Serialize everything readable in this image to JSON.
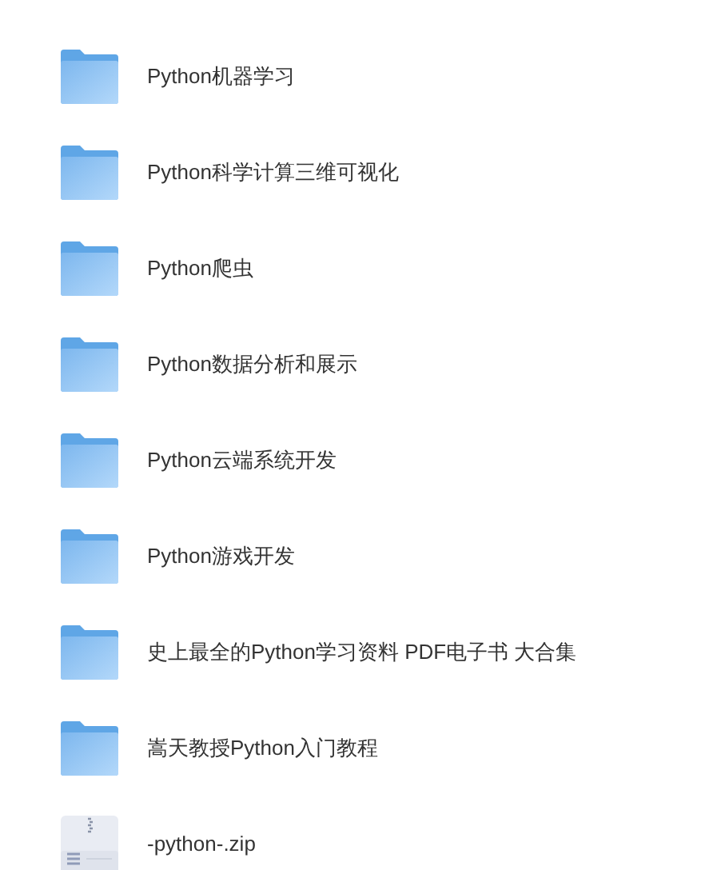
{
  "files": [
    {
      "kind": "folder",
      "name": "Python机器学习"
    },
    {
      "kind": "folder",
      "name": "Python科学计算三维可视化"
    },
    {
      "kind": "folder",
      "name": "Python爬虫"
    },
    {
      "kind": "folder",
      "name": "Python数据分析和展示"
    },
    {
      "kind": "folder",
      "name": "Python云端系统开发"
    },
    {
      "kind": "folder",
      "name": "Python游戏开发"
    },
    {
      "kind": "folder",
      "name": "史上最全的Python学习资料 PDF电子书 大合集"
    },
    {
      "kind": "folder",
      "name": "嵩天教授Python入门教程"
    },
    {
      "kind": "zip",
      "name": "-python-.zip"
    }
  ]
}
